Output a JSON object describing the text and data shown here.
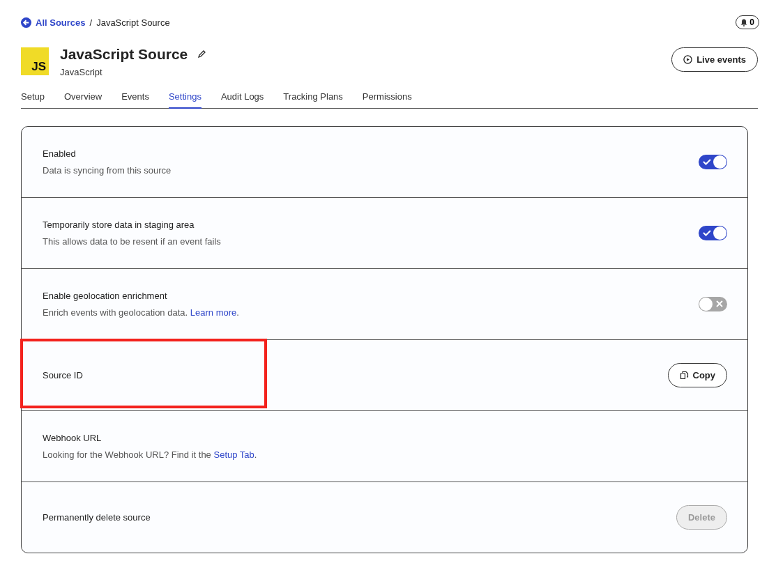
{
  "breadcrumb": {
    "link": "All Sources",
    "separator": "/",
    "current": "JavaScript Source"
  },
  "notifications": {
    "count": "0"
  },
  "header": {
    "logo": "JS",
    "title": "JavaScript Source",
    "subtitle": "JavaScript",
    "action": "Live events"
  },
  "tabs": [
    {
      "label": "Setup",
      "selected": false
    },
    {
      "label": "Overview",
      "selected": false
    },
    {
      "label": "Events",
      "selected": false
    },
    {
      "label": "Settings",
      "selected": true
    },
    {
      "label": "Audit Logs",
      "selected": false
    },
    {
      "label": "Tracking Plans",
      "selected": false
    },
    {
      "label": "Permissions",
      "selected": false
    }
  ],
  "settings": [
    {
      "kind": "toggle",
      "title": "Enabled",
      "description": "Data is syncing from this source",
      "on": true
    },
    {
      "kind": "toggle",
      "title": "Temporarily store data in staging area",
      "description": "This allows data to be resent if an event fails",
      "on": true
    },
    {
      "kind": "toggle",
      "title": "Enable geolocation enrichment",
      "description": "Enrich events with geolocation data.",
      "link": "Learn more",
      "description_end": ".",
      "on": false
    },
    {
      "kind": "copy",
      "title": "Source ID",
      "button": "Copy",
      "highlighted": true
    },
    {
      "kind": "info",
      "title": "Webhook URL",
      "description": "Looking for the Webhook URL? Find it the",
      "link": "Setup Tab",
      "description_end": "."
    },
    {
      "kind": "delete",
      "title": "Permanently delete source",
      "button": "Delete",
      "disabled": true
    }
  ]
}
